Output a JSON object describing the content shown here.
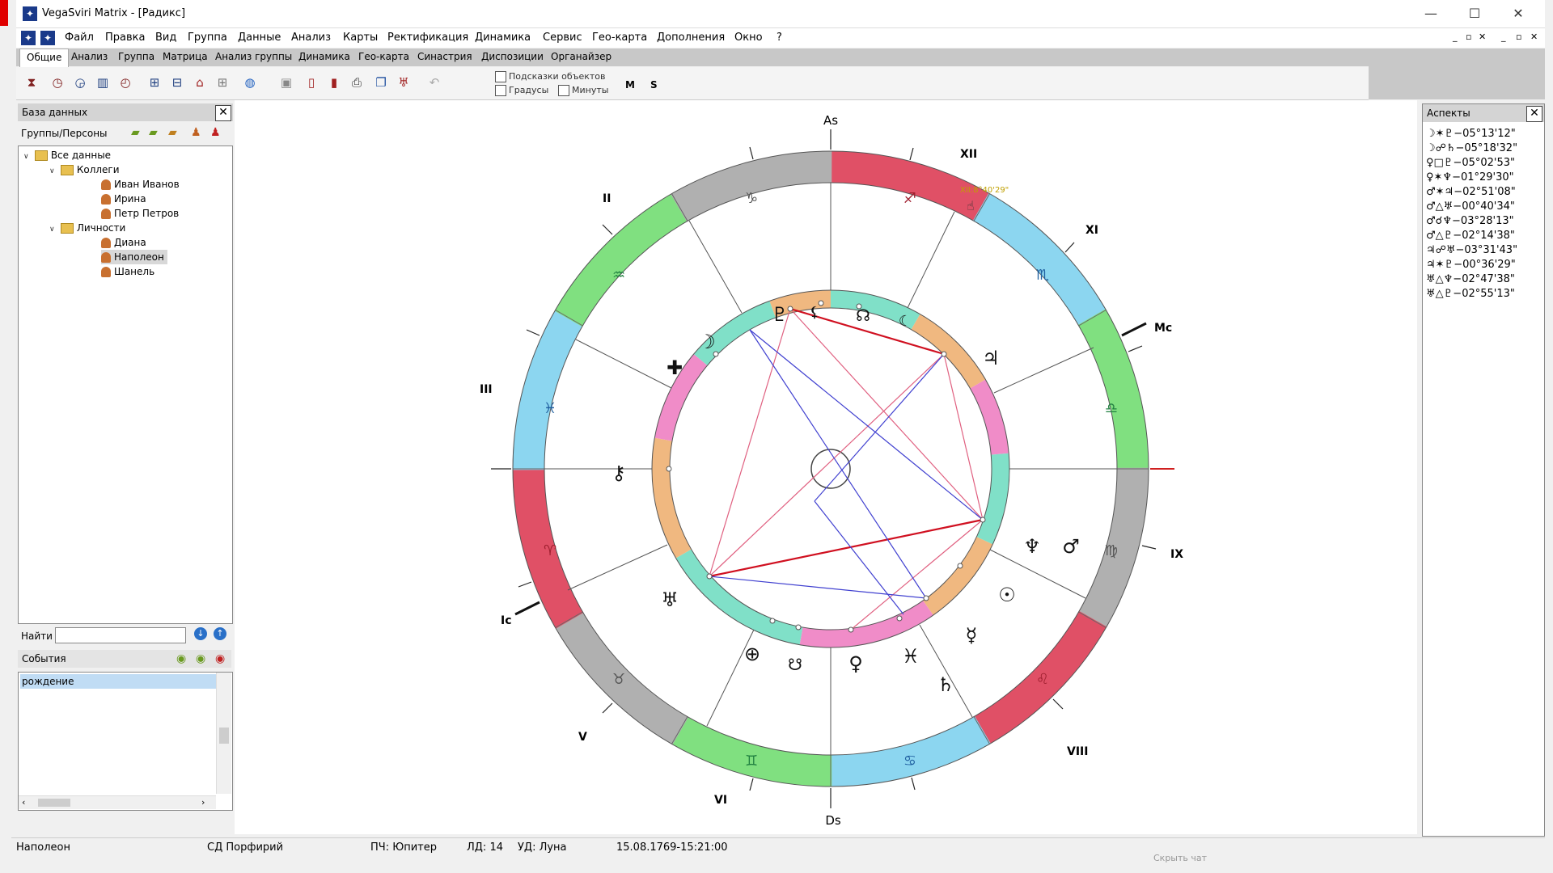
{
  "window": {
    "app_icon": "app-logo-icon",
    "title": "VegaSviri Matrix - [Радикс]",
    "minimize": "—",
    "maximize": "☐",
    "close": "✕"
  },
  "menu": {
    "items": [
      "Файл",
      "Правка",
      "Вид",
      "Группа",
      "Данные",
      "Анализ",
      "Карты",
      "Ректификация",
      "Динамика",
      "Сервис",
      "Гео-карта",
      "Дополнения",
      "Окно",
      "?"
    ],
    "mdi_controls": [
      "_",
      "▫",
      "✕",
      "_",
      "▫",
      "✕"
    ]
  },
  "tabs": [
    "Общие",
    "Анализ",
    "Группа",
    "Матрица",
    "Анализ группы",
    "Динамика",
    "Гео-карта",
    "Синастрия",
    "Диспозиции",
    "Органайзер"
  ],
  "toolbar": {
    "checkbox_hints": "Подсказки объектов",
    "checkbox_degrees": "Градусы",
    "checkbox_minutes": "Минуты",
    "btn_m": "M",
    "btn_s": "S"
  },
  "database_panel": {
    "title": "База данных",
    "groups_label": "Группы/Персоны",
    "tree": [
      {
        "label": "Все данные",
        "type": "folder",
        "level": 0,
        "expanded": true
      },
      {
        "label": "Коллеги",
        "type": "folder",
        "level": 1,
        "expanded": true
      },
      {
        "label": "Иван Иванов",
        "type": "person",
        "level": 2
      },
      {
        "label": "Ирина",
        "type": "person",
        "level": 2
      },
      {
        "label": "Петр Петров",
        "type": "person",
        "level": 2
      },
      {
        "label": "Личности",
        "type": "folder",
        "level": 1,
        "expanded": true
      },
      {
        "label": "Диана",
        "type": "person",
        "level": 2
      },
      {
        "label": "Наполеон",
        "type": "person",
        "level": 2,
        "selected": true
      },
      {
        "label": "Шанель",
        "type": "person",
        "level": 2
      }
    ],
    "find_label": "Найти",
    "find_value": "",
    "events_label": "События",
    "events": [
      "рождение"
    ]
  },
  "chart": {
    "angles": {
      "as": "As",
      "ds": "Ds",
      "mc": "Mc",
      "ic": "Ic"
    },
    "houses": [
      "XII",
      "XI",
      "IX",
      "VIII",
      "VI",
      "V",
      "III",
      "II"
    ],
    "tooltip": "XII:8°40'29\""
  },
  "aspects_panel": {
    "title": "Аспекты",
    "items": [
      "☽✶♇−05°13'12\"",
      "☽☍♄−05°18'32\"",
      "♀□♇−05°02'53\"",
      "♀✶♆−01°29'30\"",
      "♂✶♃−02°51'08\"",
      "♂△♅−00°40'34\"",
      "♂☌♆−03°28'13\"",
      "♂△♇−02°14'38\"",
      "♃☍♅−03°31'43\"",
      "♃✶♇−00°36'29\"",
      "♅△♆−02°47'38\"",
      "♅△♇−02°55'13\""
    ]
  },
  "statusbar": {
    "person": "Наполеон",
    "sd": "СД Порфирий",
    "pch": "ПЧ: Юпитер",
    "ld": "ЛД: 14",
    "ud": "УД: Луна",
    "datetime": "15.08.1769-15:21:00",
    "hint": "Скрыть чат"
  }
}
